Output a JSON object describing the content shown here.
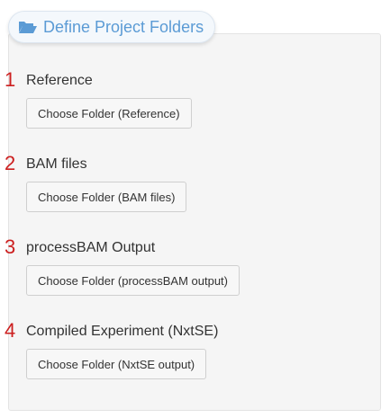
{
  "header": {
    "title": "Define Project Folders",
    "icon": "folder-open-icon",
    "title_color": "#5b9bd5"
  },
  "sections": [
    {
      "number": "1",
      "label": "Reference",
      "button_label": "Choose Folder (Reference)"
    },
    {
      "number": "2",
      "label": "BAM files",
      "button_label": "Choose Folder (BAM files)"
    },
    {
      "number": "3",
      "label": "processBAM Output",
      "button_label": "Choose Folder (processBAM output)"
    },
    {
      "number": "4",
      "label": "Compiled Experiment (NxtSE)",
      "button_label": "Choose Folder (NxtSE output)"
    }
  ],
  "colors": {
    "step_number": "#cc1f1f",
    "panel_background": "#f5f5f5"
  }
}
